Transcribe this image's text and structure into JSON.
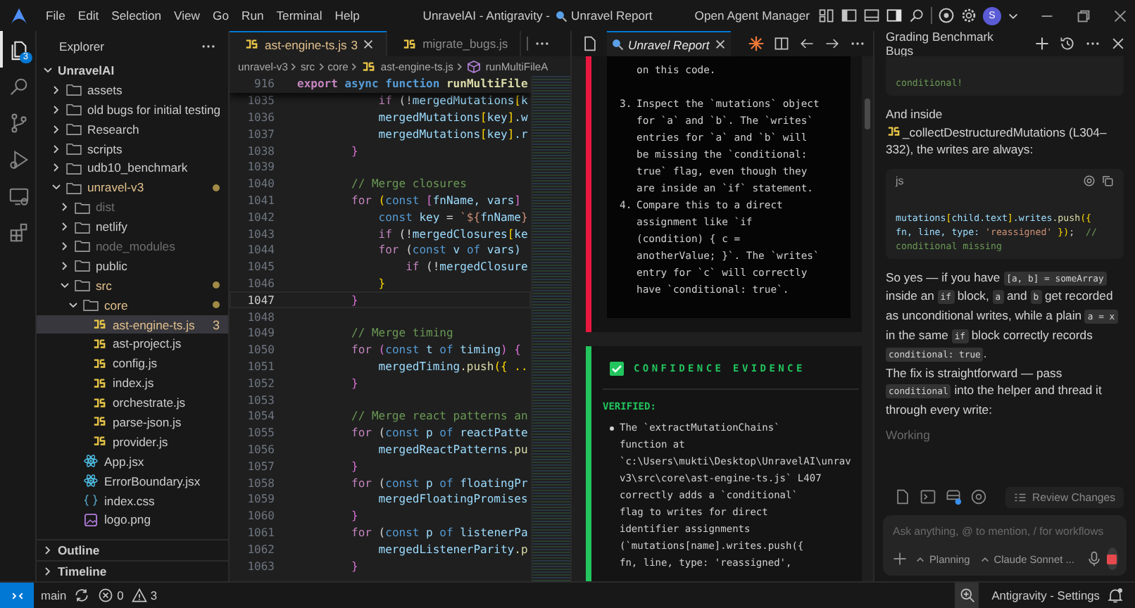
{
  "title_bar": {
    "menus": [
      "File",
      "Edit",
      "Selection",
      "View",
      "Go",
      "Run",
      "Terminal",
      "Help"
    ],
    "title": "UnravelAI - Antigravity -",
    "title_tab": "Unravel Report",
    "agent_manager": "Open Agent Manager",
    "avatar": "S"
  },
  "activity_bar": {
    "items": [
      {
        "kind": "files",
        "selected": true,
        "badge": "3"
      },
      {
        "kind": "search",
        "selected": false
      },
      {
        "kind": "source-control",
        "selected": false
      },
      {
        "kind": "run",
        "selected": false
      },
      {
        "kind": "remote",
        "selected": false
      },
      {
        "kind": "extensions",
        "selected": false
      }
    ]
  },
  "explorer": {
    "title": "Explorer",
    "root": {
      "label": "UnravelAI",
      "kind": "folder",
      "expanded": true,
      "modified": false,
      "ignored": false,
      "selected": false,
      "children": [
        {
          "label": "assets",
          "kind": "folder",
          "expanded": false,
          "modified": false,
          "ignored": false,
          "selected": false
        },
        {
          "label": "old bugs for initial testing",
          "kind": "folder",
          "expanded": false,
          "modified": false,
          "ignored": false,
          "selected": false
        },
        {
          "label": "Research",
          "kind": "folder",
          "expanded": false,
          "modified": false,
          "ignored": false,
          "selected": false
        },
        {
          "label": "scripts",
          "kind": "folder",
          "expanded": false,
          "modified": false,
          "ignored": false,
          "selected": false
        },
        {
          "label": "udb10_benchmark",
          "kind": "folder",
          "expanded": false,
          "modified": false,
          "ignored": false,
          "selected": false
        },
        {
          "label": "unravel-v3",
          "kind": "folder",
          "expanded": true,
          "modified": true,
          "ignored": false,
          "selected": false,
          "children": [
            {
              "label": "dist",
              "kind": "folder",
              "expanded": false,
              "modified": false,
              "ignored": true,
              "selected": false
            },
            {
              "label": "netlify",
              "kind": "folder",
              "expanded": false,
              "modified": false,
              "ignored": false,
              "selected": false
            },
            {
              "label": "node_modules",
              "kind": "folder",
              "expanded": false,
              "modified": false,
              "ignored": true,
              "selected": false
            },
            {
              "label": "public",
              "kind": "folder",
              "expanded": false,
              "modified": false,
              "ignored": false,
              "selected": false
            },
            {
              "label": "src",
              "kind": "folder",
              "expanded": true,
              "modified": true,
              "ignored": false,
              "selected": false,
              "children": [
                {
                  "label": "core",
                  "kind": "folder",
                  "expanded": true,
                  "modified": true,
                  "ignored": false,
                  "selected": false,
                  "children": [
                    {
                      "label": "ast-engine-ts.js",
                      "kind": "js",
                      "modified": true,
                      "ignored": false,
                      "selected": true,
                      "badge": "3"
                    },
                    {
                      "label": "ast-project.js",
                      "kind": "js",
                      "modified": false,
                      "ignored": false,
                      "selected": false
                    },
                    {
                      "label": "config.js",
                      "kind": "js",
                      "modified": false,
                      "ignored": false,
                      "selected": false
                    },
                    {
                      "label": "index.js",
                      "kind": "js",
                      "modified": false,
                      "ignored": false,
                      "selected": false
                    },
                    {
                      "label": "orchestrate.js",
                      "kind": "js",
                      "modified": false,
                      "ignored": false,
                      "selected": false
                    },
                    {
                      "label": "parse-json.js",
                      "kind": "js",
                      "modified": false,
                      "ignored": false,
                      "selected": false
                    },
                    {
                      "label": "provider.js",
                      "kind": "js",
                      "modified": false,
                      "ignored": false,
                      "selected": false
                    }
                  ]
                },
                {
                  "label": "App.jsx",
                  "kind": "react",
                  "modified": false,
                  "ignored": false,
                  "selected": false
                },
                {
                  "label": "ErrorBoundary.jsx",
                  "kind": "react",
                  "modified": false,
                  "ignored": false,
                  "selected": false
                },
                {
                  "label": "index.css",
                  "kind": "css",
                  "modified": false,
                  "ignored": false,
                  "selected": false
                },
                {
                  "label": "logo.png",
                  "kind": "image",
                  "modified": false,
                  "ignored": false,
                  "selected": false
                }
              ]
            }
          ]
        }
      ]
    },
    "sections": [
      {
        "label": "Outline",
        "expanded": false
      },
      {
        "label": "Timeline",
        "expanded": false
      }
    ]
  },
  "editor": {
    "tabs": [
      {
        "label": "ast-engine-ts.js",
        "badge": "3",
        "modified": true,
        "selected": true
      },
      {
        "label": "migrate_bugs.js",
        "modified": false,
        "selected": false
      }
    ],
    "breadcrumb": [
      {
        "label": "unravel-v3",
        "kind": "folder"
      },
      {
        "label": "src",
        "kind": "folder"
      },
      {
        "label": "core",
        "kind": "folder"
      },
      {
        "label": "ast-engine-ts.js",
        "kind": "js"
      },
      {
        "label": "runMultiFileA",
        "kind": "symbol"
      }
    ],
    "sticky": {
      "number": "916",
      "tokens": [
        {
          "kind": "control",
          "text": "export"
        },
        {
          "kind": "keyword",
          "text": " async"
        },
        {
          "kind": "keyword",
          "text": " function"
        },
        {
          "kind": "func",
          "text": " runMultiFile"
        }
      ]
    },
    "lines": [
      {
        "number": "1035",
        "selected": false,
        "tokens": [
          {
            "kind": "control",
            "text": "            if"
          },
          {
            "kind": "punct",
            "text": " (!"
          },
          {
            "kind": "var",
            "text": "mergedMutations"
          },
          {
            "kind": "bracket",
            "text": "["
          },
          {
            "kind": "var",
            "text": "k"
          }
        ]
      },
      {
        "number": "1036",
        "selected": false,
        "tokens": [
          {
            "kind": "var",
            "text": "            mergedMutations"
          },
          {
            "kind": "bracket",
            "text": "["
          },
          {
            "kind": "var",
            "text": "key"
          },
          {
            "kind": "bracket",
            "text": "]"
          },
          {
            "kind": "var",
            "text": ".w"
          }
        ]
      },
      {
        "number": "1037",
        "selected": false,
        "tokens": [
          {
            "kind": "var",
            "text": "            mergedMutations"
          },
          {
            "kind": "bracket",
            "text": "["
          },
          {
            "kind": "var",
            "text": "key"
          },
          {
            "kind": "bracket",
            "text": "]"
          },
          {
            "kind": "var",
            "text": ".r"
          }
        ]
      },
      {
        "number": "1038",
        "selected": false,
        "tokens": [
          {
            "kind": "bracket2",
            "text": "        }"
          }
        ]
      },
      {
        "number": "1039",
        "selected": false
      },
      {
        "number": "1040",
        "selected": false,
        "tokens": [
          {
            "kind": "comment",
            "text": "        // Merge closures"
          }
        ]
      },
      {
        "number": "1041",
        "selected": false,
        "tokens": [
          {
            "kind": "control",
            "text": "        for"
          },
          {
            "kind": "bracket",
            "text": " ("
          },
          {
            "kind": "keyword",
            "text": "const"
          },
          {
            "kind": "bracket2",
            "text": " ["
          },
          {
            "kind": "var",
            "text": "fnName, vars"
          },
          {
            "kind": "bracket2",
            "text": "]"
          }
        ]
      },
      {
        "number": "1042",
        "selected": false,
        "tokens": [
          {
            "kind": "keyword",
            "text": "            const"
          },
          {
            "kind": "var",
            "text": " key"
          },
          {
            "kind": "punct",
            "text": " = "
          },
          {
            "kind": "string",
            "text": "`${"
          },
          {
            "kind": "var",
            "text": "fnName"
          },
          {
            "kind": "string",
            "text": "}"
          }
        ]
      },
      {
        "number": "1043",
        "selected": false,
        "tokens": [
          {
            "kind": "control",
            "text": "            if"
          },
          {
            "kind": "punct",
            "text": " (!"
          },
          {
            "kind": "var",
            "text": "mergedClosures"
          },
          {
            "kind": "bracket",
            "text": "["
          },
          {
            "kind": "var",
            "text": "ke"
          }
        ]
      },
      {
        "number": "1044",
        "selected": false,
        "tokens": [
          {
            "kind": "control",
            "text": "            for"
          },
          {
            "kind": "punct",
            "text": " ("
          },
          {
            "kind": "keyword",
            "text": "const"
          },
          {
            "kind": "var",
            "text": " v"
          },
          {
            "kind": "keyword",
            "text": " of"
          },
          {
            "kind": "var",
            "text": " vars)"
          }
        ]
      },
      {
        "number": "1045",
        "selected": false,
        "tokens": [
          {
            "kind": "control",
            "text": "                if"
          },
          {
            "kind": "punct",
            "text": " (!"
          },
          {
            "kind": "var",
            "text": "mergedClosure"
          }
        ]
      },
      {
        "number": "1046",
        "selected": false,
        "tokens": [
          {
            "kind": "bracket",
            "text": "            }"
          }
        ]
      },
      {
        "number": "1047",
        "selected": true,
        "tokens": [
          {
            "kind": "bracket2",
            "text": "        }"
          }
        ]
      },
      {
        "number": "1048",
        "selected": false
      },
      {
        "number": "1049",
        "selected": false,
        "tokens": [
          {
            "kind": "comment",
            "text": "        // Merge timing"
          }
        ]
      },
      {
        "number": "1050",
        "selected": false,
        "tokens": [
          {
            "kind": "control",
            "text": "        for"
          },
          {
            "kind": "bracket2",
            "text": " ("
          },
          {
            "kind": "keyword",
            "text": "const"
          },
          {
            "kind": "var",
            "text": " t"
          },
          {
            "kind": "keyword",
            "text": " of"
          },
          {
            "kind": "var",
            "text": " timing"
          },
          {
            "kind": "bracket2",
            "text": ") {"
          }
        ]
      },
      {
        "number": "1051",
        "selected": false,
        "tokens": [
          {
            "kind": "var",
            "text": "            mergedTiming"
          },
          {
            "kind": "func",
            "text": ".push"
          },
          {
            "kind": "bracket",
            "text": "({ .."
          }
        ]
      },
      {
        "number": "1052",
        "selected": false,
        "tokens": [
          {
            "kind": "bracket2",
            "text": "        }"
          }
        ]
      },
      {
        "number": "1053",
        "selected": false
      },
      {
        "number": "1054",
        "selected": false,
        "tokens": [
          {
            "kind": "comment",
            "text": "        // Merge react patterns an"
          }
        ]
      },
      {
        "number": "1055",
        "selected": false,
        "tokens": [
          {
            "kind": "control",
            "text": "        for"
          },
          {
            "kind": "punct",
            "text": " ("
          },
          {
            "kind": "keyword",
            "text": "const"
          },
          {
            "kind": "var",
            "text": " p"
          },
          {
            "kind": "keyword",
            "text": " of"
          },
          {
            "kind": "var",
            "text": " reactPatte"
          }
        ]
      },
      {
        "number": "1056",
        "selected": false,
        "tokens": [
          {
            "kind": "var",
            "text": "            mergedReactPatterns"
          },
          {
            "kind": "func",
            "text": ".pu"
          }
        ]
      },
      {
        "number": "1057",
        "selected": false,
        "tokens": [
          {
            "kind": "bracket2",
            "text": "        }"
          }
        ]
      },
      {
        "number": "1058",
        "selected": false,
        "tokens": [
          {
            "kind": "control",
            "text": "        for"
          },
          {
            "kind": "punct",
            "text": " ("
          },
          {
            "kind": "keyword",
            "text": "const"
          },
          {
            "kind": "var",
            "text": " p"
          },
          {
            "kind": "keyword",
            "text": " of"
          },
          {
            "kind": "var",
            "text": " floatingPr"
          }
        ]
      },
      {
        "number": "1059",
        "selected": false,
        "tokens": [
          {
            "kind": "var",
            "text": "            mergedFloatingPromises"
          }
        ]
      },
      {
        "number": "1060",
        "selected": false,
        "tokens": [
          {
            "kind": "bracket2",
            "text": "        }"
          }
        ]
      },
      {
        "number": "1061",
        "selected": false,
        "tokens": [
          {
            "kind": "control",
            "text": "        for"
          },
          {
            "kind": "punct",
            "text": " ("
          },
          {
            "kind": "keyword",
            "text": "const"
          },
          {
            "kind": "var",
            "text": " p"
          },
          {
            "kind": "keyword",
            "text": " of"
          },
          {
            "kind": "var",
            "text": " listenerPa"
          }
        ]
      },
      {
        "number": "1062",
        "selected": false,
        "tokens": [
          {
            "kind": "var",
            "text": "            mergedListenerParity"
          },
          {
            "kind": "func",
            "text": ".p"
          }
        ]
      },
      {
        "number": "1063",
        "selected": false,
        "tokens": [
          {
            "kind": "bracket2",
            "text": "        }"
          }
        ]
      }
    ]
  },
  "report": {
    "tabs": [
      {
        "label": "Unravel Report",
        "selected": true
      }
    ],
    "steps_card": {
      "color": "#e8173f",
      "fragment": "on this code.",
      "items": [
        {
          "number": "3.",
          "lines": [
            "Inspect the `mutations` object",
            "for `a` and `b`. The `writes`",
            "entries for `a` and `b` will",
            "be missing the `conditional:",
            "true` flag, even though they",
            "are inside an `if` statement."
          ]
        },
        {
          "number": "4.",
          "lines": [
            "Compare this to a direct",
            "assignment like `if",
            "(condition) { c =",
            "anotherValue; }`. The `writes`",
            "entry for `c` will correctly",
            "have `conditional: true`."
          ]
        }
      ]
    },
    "evidence_card": {
      "color": "#22c55e",
      "heading": "CONFIDENCE EVIDENCE",
      "label": "VERIFIED:",
      "bullets": [
        {
          "lines": [
            "The `extractMutationChains`",
            "function at",
            "`c:\\Users\\mukti\\Desktop\\UnravelAI\\unrav",
            "v3\\src\\core\\ast-engine-ts.js` L407",
            "correctly adds a `conditional`",
            "flag to writes for direct",
            "identifier assignments",
            "(`mutations[name].writes.push({",
            "fn, line, type: 'reassigned',"
          ]
        }
      ]
    }
  },
  "chat": {
    "title": "Grading Benchmark Bugs",
    "blocks": [
      {
        "kind": "code",
        "lines": [
          {
            "tokens": [
              {
                "kind": "comment",
                "text": "conditional!"
              }
            ]
          }
        ]
      },
      {
        "kind": "paragraph",
        "segments": [
          {
            "kind": "text",
            "text": "And inside "
          },
          {
            "kind": "file",
            "text": "_collectDestructuredMutations"
          },
          {
            "kind": "text",
            "text": " (L304–332), the writes are always:"
          }
        ]
      },
      {
        "kind": "code",
        "language": "js",
        "lines": [
          {
            "tokens": [
              {
                "kind": "var",
                "text": "mutations"
              },
              {
                "kind": "bracket",
                "text": "["
              },
              {
                "kind": "var",
                "text": "child.text"
              },
              {
                "kind": "bracket",
                "text": "]"
              },
              {
                "kind": "var",
                "text": ".writes"
              },
              {
                "kind": "func",
                "text": ".push"
              },
              {
                "kind": "bracket",
                "text": "({"
              }
            ]
          },
          {
            "tokens": [
              {
                "kind": "var",
                "text": "fn, line, type:"
              },
              {
                "kind": "string",
                "text": " 'reassigned'"
              },
              {
                "kind": "bracket",
                "text": " })"
              },
              {
                "kind": "punct",
                "text": ";"
              },
              {
                "kind": "comment",
                "text": "  //"
              }
            ]
          },
          {
            "tokens": [
              {
                "kind": "comment",
                "text": "conditional missing"
              }
            ]
          }
        ]
      },
      {
        "kind": "paragraph",
        "segments": [
          {
            "kind": "text",
            "text": "So yes — if you have "
          },
          {
            "kind": "code",
            "text": "[a, b] = someArray"
          },
          {
            "kind": "text",
            "text": " inside an "
          },
          {
            "kind": "code",
            "text": "if"
          },
          {
            "kind": "text",
            "text": " block, "
          },
          {
            "kind": "code",
            "text": "a"
          },
          {
            "kind": "text",
            "text": " and "
          },
          {
            "kind": "code",
            "text": "b"
          },
          {
            "kind": "text",
            "text": " get recorded as unconditional writes, while a plain "
          },
          {
            "kind": "code",
            "text": "a = x"
          },
          {
            "kind": "text",
            "text": " in the same "
          },
          {
            "kind": "code",
            "text": "if"
          },
          {
            "kind": "text",
            "text": " block correctly records "
          },
          {
            "kind": "code",
            "text": "conditional: true"
          },
          {
            "kind": "text",
            "text": "."
          }
        ]
      },
      {
        "kind": "paragraph",
        "segments": [
          {
            "kind": "text",
            "text": "The fix is straightforward — pass "
          },
          {
            "kind": "code",
            "text": "conditional"
          },
          {
            "kind": "text",
            "text": " into the helper and thread it through every write:"
          }
        ]
      },
      {
        "kind": "status",
        "text": "Working"
      }
    ],
    "review_button": "Review Changes",
    "composer": {
      "placeholder": "Ask anything, @ to mention, / for workflows",
      "mode": "Planning",
      "model": "Claude Sonnet ..."
    }
  },
  "status_bar": {
    "branch": "main",
    "errors": "0",
    "warnings": "3",
    "settings": "Antigravity - Settings"
  }
}
